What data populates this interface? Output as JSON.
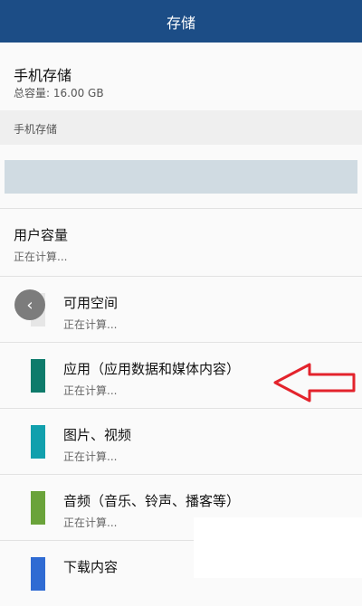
{
  "header": {
    "title": "存储"
  },
  "overview": {
    "title": "手机存储",
    "total_capacity": "总容量: 16.00 GB"
  },
  "section": {
    "title": "手机存储"
  },
  "usage": {
    "bar_color": "#d0dbe2"
  },
  "user_capacity": {
    "label": "用户容量",
    "status": "正在计算..."
  },
  "categories": [
    {
      "label": "可用空间",
      "status": "正在计算...",
      "color": "#e6e6e6"
    },
    {
      "label": "应用（应用数据和媒体内容）",
      "status": "正在计算...",
      "color": "#0e7b6b"
    },
    {
      "label": "图片、视频",
      "status": "正在计算...",
      "color": "#11a0ad"
    },
    {
      "label": "音频（音乐、铃声、播客等）",
      "status": "正在计算...",
      "color": "#6aa33a"
    },
    {
      "label": "下载内容",
      "status": "",
      "color": "#2f6bd3"
    }
  ],
  "back_button": {
    "icon": "chevron-left-icon",
    "glyph": "‹"
  },
  "annotation": {
    "arrow_color": "#e3232c"
  }
}
